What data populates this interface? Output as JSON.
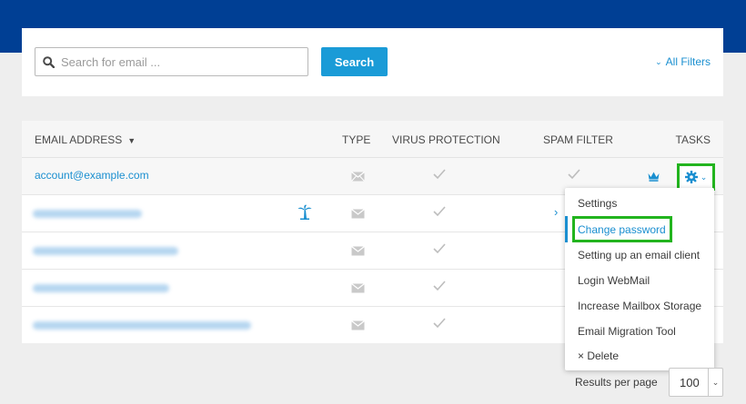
{
  "search": {
    "placeholder": "Search for email ...",
    "button_label": "Search",
    "filters_label": "All Filters"
  },
  "table": {
    "headers": {
      "email": "EMAIL ADDRESS",
      "type": "TYPE",
      "virus": "VIRUS PROTECTION",
      "spam": "SPAM FILTER",
      "tasks": "TASKS"
    },
    "rows": [
      {
        "email": "account@example.com"
      }
    ]
  },
  "menu": {
    "items": [
      "Settings",
      "Change password",
      "Setting up an email client",
      "Login WebMail",
      "Increase Mailbox Storage",
      "Email Migration Tool",
      "Delete"
    ]
  },
  "pagination": {
    "results_label": "Results per page",
    "per_page_value": "100"
  },
  "colors": {
    "header_band": "#003f94",
    "accent": "#1a9bd7",
    "highlight": "#22b41e"
  }
}
